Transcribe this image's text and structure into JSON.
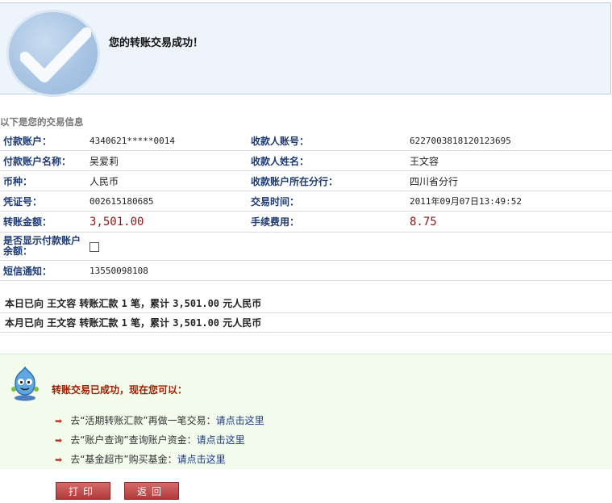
{
  "banner": {
    "title": "您的转账交易成功！"
  },
  "section_caption": "以下是您的交易信息",
  "info_rows": [
    {
      "l1": "付款账户：",
      "v1": "4340621*****0014",
      "l2": "收款人账号：",
      "v2": "6227003818120123695"
    },
    {
      "l1": "付款账户名称：",
      "v1": "吴爱莉",
      "l2": "收款人姓名：",
      "v2": "王文容"
    },
    {
      "l1": "币种：",
      "v1": "人民币",
      "l2": "收款账户所在分行：",
      "v2": "四川省分行"
    },
    {
      "l1": "凭证号：",
      "v1": "002615180685",
      "l2": "交易时间：",
      "v2": "2011年09月07日13:49:52"
    },
    {
      "l1": "转账金额：",
      "v1": "3,501.00",
      "l2": "手续费用：",
      "v2": "8.75"
    },
    {
      "l1": "是否显示付款账户余额：",
      "v1_checkbox": false
    },
    {
      "l1": "短信通知：",
      "v1": "13550098108"
    }
  ],
  "summary": {
    "day": {
      "prefix": "本日已向",
      "name": "王文容",
      "mid": "转账汇款",
      "count": "1",
      "unit": "笔，累计",
      "amount": "3,501.00",
      "currency": "元人民币"
    },
    "month": {
      "prefix": "本月已向",
      "name": "王文容",
      "mid": "转账汇款",
      "count": "1",
      "unit": "笔，累计",
      "amount": "3,501.00",
      "currency": "元人民币"
    }
  },
  "next": {
    "title": "转账交易已成功，现在您可以：",
    "items": [
      {
        "text": "去“活期转账汇款”再做一笔交易：",
        "link": "请点击这里"
      },
      {
        "text": "去“账户查询”查询账户资金：",
        "link": "请点击这里"
      },
      {
        "text": "去“基金超市”购买基金：",
        "link": "请点击这里"
      }
    ]
  },
  "buttons": {
    "print": "打印",
    "back": "返回"
  },
  "icons": {
    "banner": "check-icon",
    "mascot": "mascot-icon",
    "bullet": "arrow-right-icon"
  },
  "colors": {
    "banner_bg": "#eef4fb",
    "label": "#1f3b73",
    "amount": "#8b1a1a",
    "next_title": "#a02000",
    "button": "#b03a3a"
  }
}
